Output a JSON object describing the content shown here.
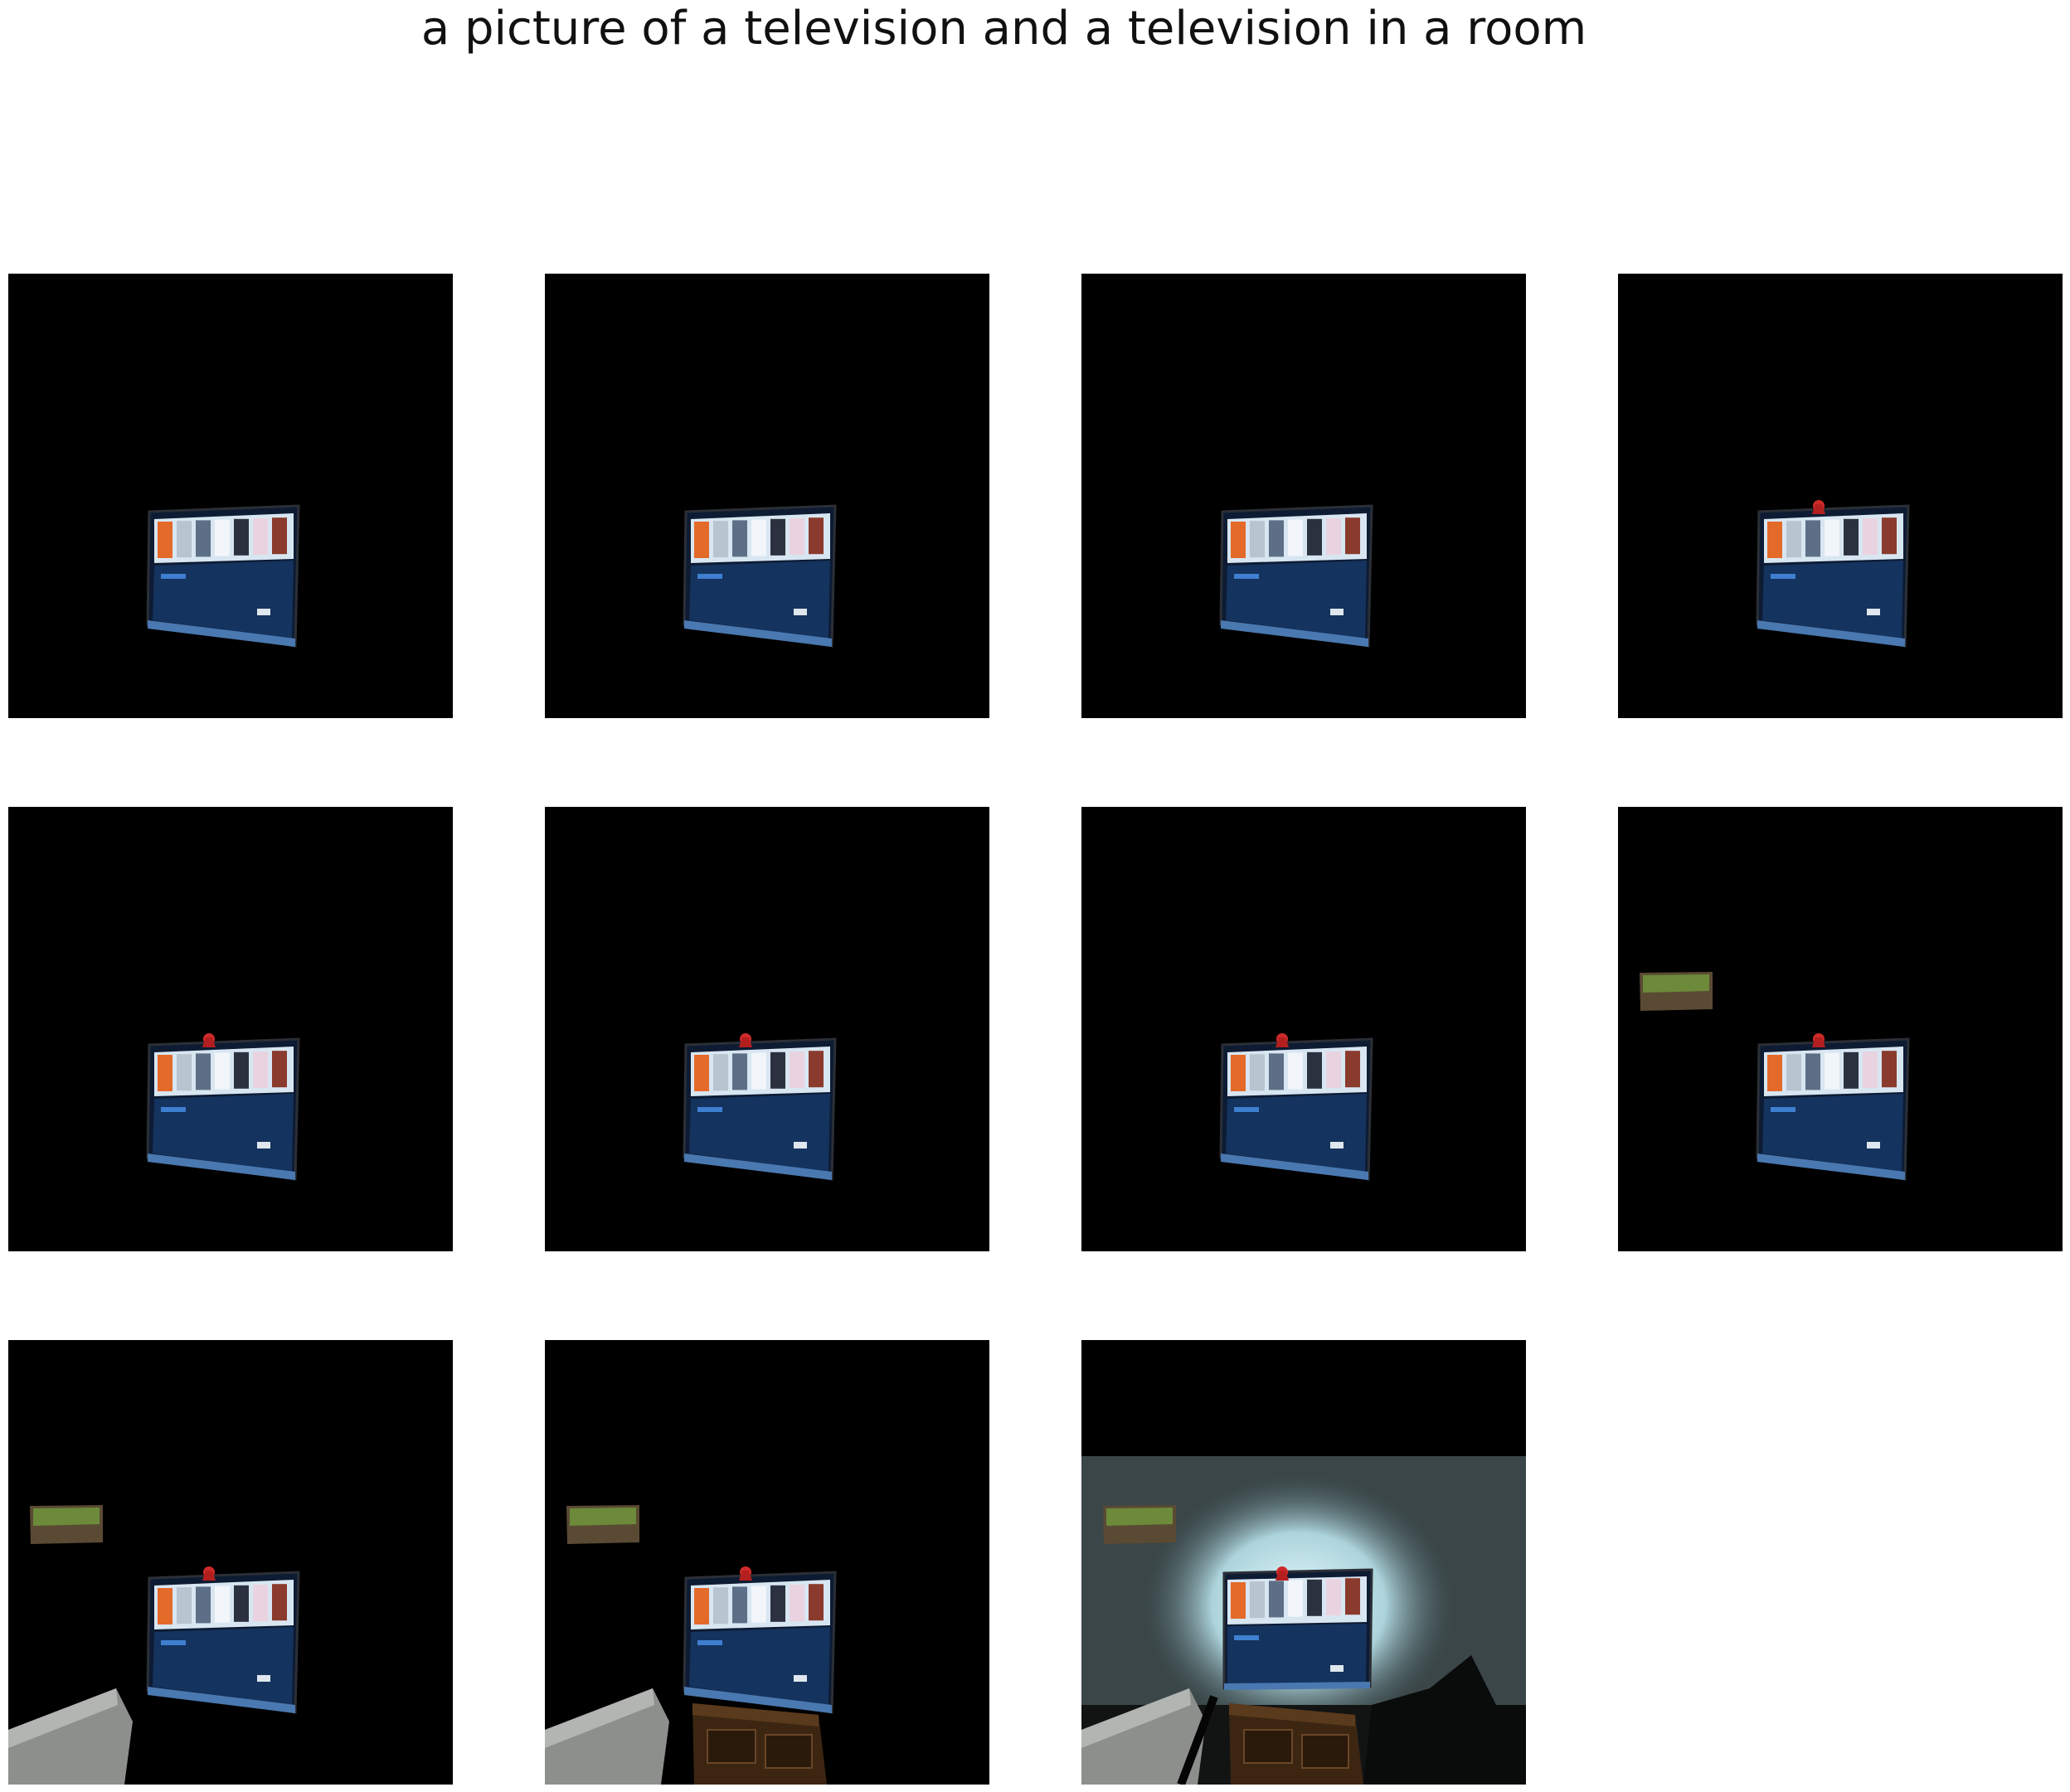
{
  "title": "a picture of a television and a television in a room",
  "frames": [
    {
      "id": 1,
      "tv_tilt": "low",
      "figure_on_top": false,
      "wall_picture": false,
      "floor_left": false,
      "cabinet": false,
      "lit_wall": false
    },
    {
      "id": 2,
      "tv_tilt": "low",
      "figure_on_top": false,
      "wall_picture": false,
      "floor_left": false,
      "cabinet": false,
      "lit_wall": false
    },
    {
      "id": 3,
      "tv_tilt": "low",
      "figure_on_top": false,
      "wall_picture": false,
      "floor_left": false,
      "cabinet": false,
      "lit_wall": false
    },
    {
      "id": 4,
      "tv_tilt": "low",
      "figure_on_top": true,
      "wall_picture": false,
      "floor_left": false,
      "cabinet": false,
      "lit_wall": false
    },
    {
      "id": 5,
      "tv_tilt": "low",
      "figure_on_top": true,
      "wall_picture": false,
      "floor_left": false,
      "cabinet": false,
      "lit_wall": false
    },
    {
      "id": 6,
      "tv_tilt": "low",
      "figure_on_top": true,
      "wall_picture": false,
      "floor_left": false,
      "cabinet": false,
      "lit_wall": false
    },
    {
      "id": 7,
      "tv_tilt": "low",
      "figure_on_top": true,
      "wall_picture": false,
      "floor_left": false,
      "cabinet": false,
      "lit_wall": false
    },
    {
      "id": 8,
      "tv_tilt": "low",
      "figure_on_top": true,
      "wall_picture": true,
      "floor_left": false,
      "cabinet": false,
      "lit_wall": false
    },
    {
      "id": 9,
      "tv_tilt": "low",
      "figure_on_top": true,
      "wall_picture": true,
      "floor_left": true,
      "cabinet": false,
      "lit_wall": false
    },
    {
      "id": 10,
      "tv_tilt": "low",
      "figure_on_top": true,
      "wall_picture": true,
      "floor_left": true,
      "cabinet": true,
      "lit_wall": false
    },
    {
      "id": 11,
      "tv_tilt": "flat",
      "figure_on_top": true,
      "wall_picture": true,
      "floor_left": true,
      "cabinet": true,
      "lit_wall": true
    }
  ]
}
